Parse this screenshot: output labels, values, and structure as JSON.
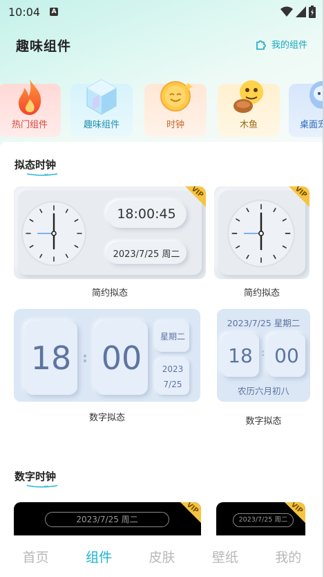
{
  "status_bar": {
    "time": "10:04",
    "notification_letter": "A"
  },
  "header": {
    "title": "趣味组件",
    "my_widgets_label": "我的组件"
  },
  "categories": [
    {
      "label": "热门组件",
      "icon": "fire-icon"
    },
    {
      "label": "趣味组件",
      "icon": "cube-icon"
    },
    {
      "label": "时钟",
      "icon": "smiley-icon"
    },
    {
      "label": "木鱼",
      "icon": "wooden-fish-icon"
    },
    {
      "label": "桌面宠",
      "icon": "pet-icon"
    }
  ],
  "sections": {
    "neumorphic": {
      "title": "拟态时钟"
    },
    "digital": {
      "title": "数字时钟"
    }
  },
  "widgets": {
    "simple_wide": {
      "time": "18:00:45",
      "date": "2023/7/25 周二",
      "caption": "简约拟态",
      "badge": "VIP"
    },
    "simple_small": {
      "caption": "简约拟态",
      "badge": "VIP"
    },
    "digital_wide": {
      "hour": "18",
      "minute": "00",
      "weekday": "星期二",
      "year": "2023",
      "month_day": "7/25",
      "caption": "数字拟态"
    },
    "digital_small": {
      "date": "2023/7/25 星期二",
      "hour": "18",
      "minute": "00",
      "lunar": "农历六月初八",
      "caption": "数字拟态"
    },
    "dark_wide": {
      "date": "2023/7/25  周二",
      "badge": "VIP"
    },
    "dark_small": {
      "date": "2023/7/25 周二",
      "badge": "VIP"
    }
  },
  "tabs": [
    {
      "label": "首页",
      "active": false
    },
    {
      "label": "组件",
      "active": true
    },
    {
      "label": "皮肤",
      "active": false
    },
    {
      "label": "壁纸",
      "active": false
    },
    {
      "label": "我的",
      "active": false
    }
  ],
  "colors": {
    "accent": "#1ab3cf",
    "vip_gold": "#f5c542"
  }
}
